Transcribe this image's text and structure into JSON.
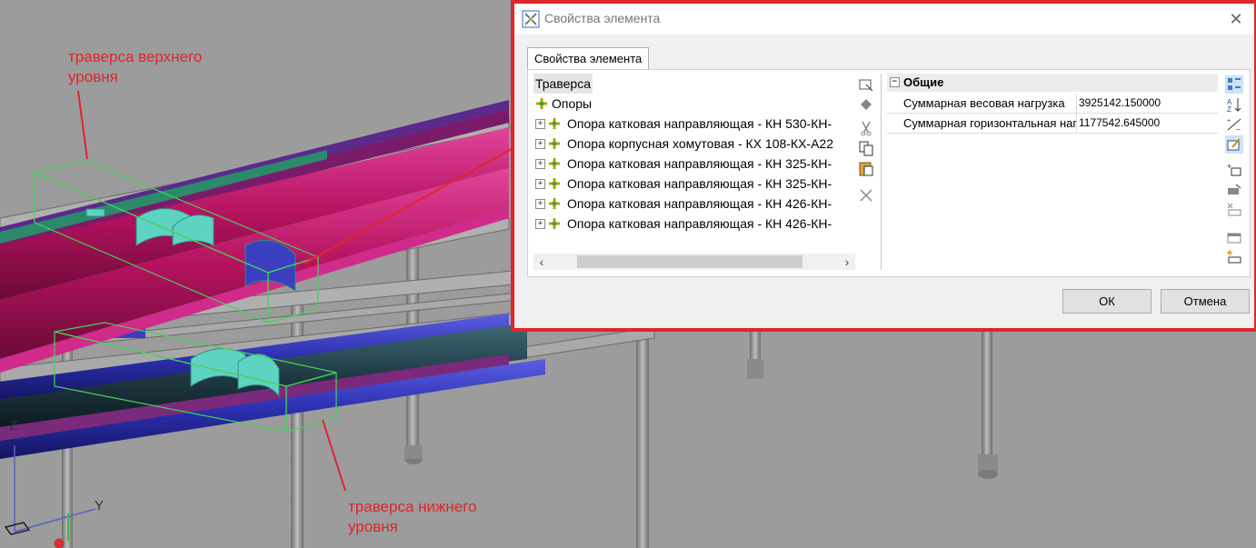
{
  "annotations": {
    "upper_label": "траверса верхнего\nуровня",
    "lower_label": "траверса нижнего\nуровня"
  },
  "axes": {
    "z": "Z",
    "y": "Y"
  },
  "dialog": {
    "title": "Свойства элемента",
    "tab_label": "Свойства элемента",
    "tree": {
      "root": "Траверса",
      "group": "Опоры",
      "items": [
        "Опора катковая направляющая - КН 530-КН-",
        "Опора корпусная хомутовая - КХ 108-КХ-А22",
        "Опора катковая направляющая - КН 325-КН-",
        "Опора катковая направляющая - КН 325-КН-",
        "Опора катковая направляющая - КН 426-КН-",
        "Опора катковая направляющая - КН 426-КН-"
      ]
    },
    "properties": {
      "category": "Общие",
      "rows": [
        {
          "name": "Суммарная весовая нагрузка",
          "value": "3925142.150000"
        },
        {
          "name": "Суммарная горизонтальная нагрузка",
          "value": "1177542.645000"
        }
      ]
    },
    "buttons": {
      "ok": "ОК",
      "cancel": "Отмена"
    }
  },
  "colors": {
    "annotation_red": "#e0252b",
    "pipe_magenta": "#b5125f",
    "pipe_blue": "#2b2fb0",
    "pipe_dark_teal": "#1f3a44",
    "support_cyan": "#5fd3c3",
    "bbox_green": "#49d05a",
    "steel_gray": "#8c8c8c"
  }
}
